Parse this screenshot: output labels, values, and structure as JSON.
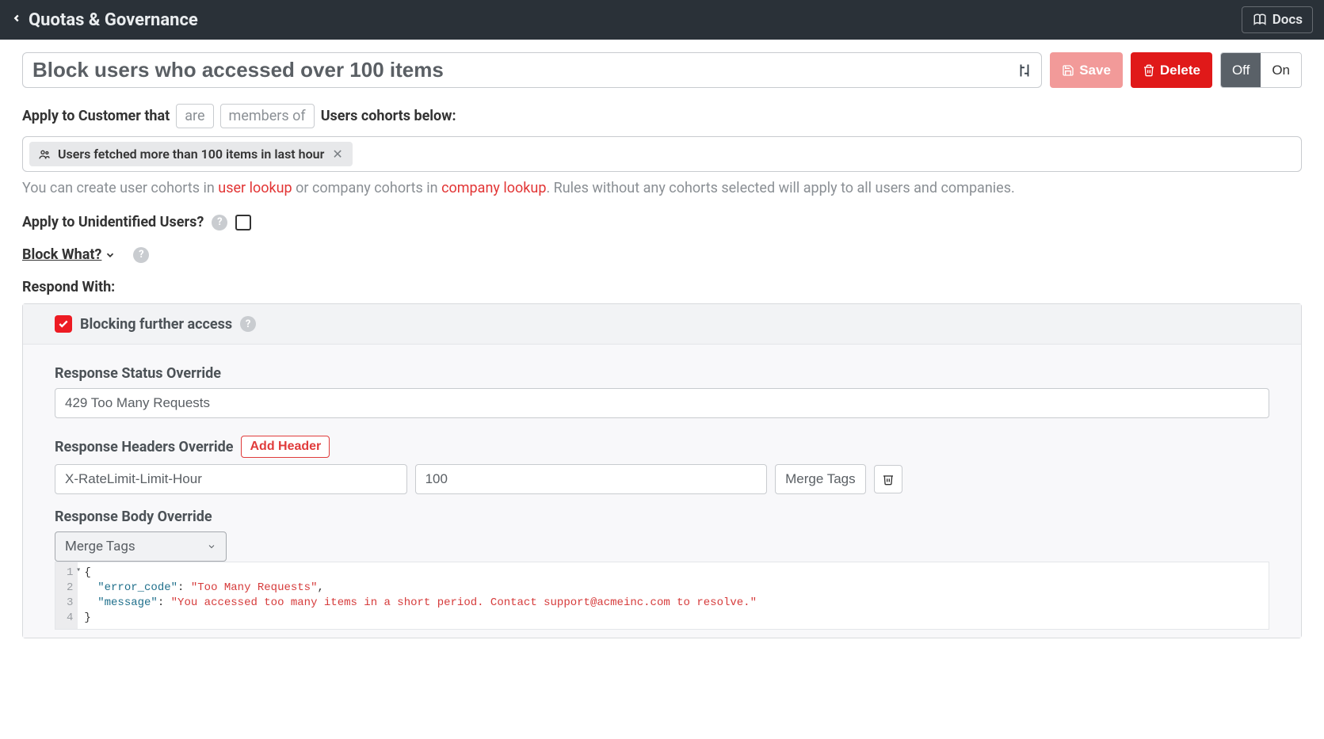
{
  "topbar": {
    "title": "Quotas & Governance",
    "docs_label": "Docs"
  },
  "rule": {
    "name": "Block users who accessed over 100 items",
    "save_label": "Save",
    "delete_label": "Delete",
    "toggle_off": "Off",
    "toggle_on": "On"
  },
  "apply": {
    "prefix": "Apply to Customer that",
    "are": "are",
    "members_of": "members of",
    "suffix": "Users cohorts below:"
  },
  "cohort": {
    "chip_label": "Users fetched more than 100 items in last hour"
  },
  "hint": {
    "p1": "You can create user cohorts in ",
    "link1": "user lookup",
    "p2": " or company cohorts in ",
    "link2": "company lookup",
    "p3": ". Rules without any cohorts selected will apply to all users and companies."
  },
  "unidentified_label": "Apply to Unidentified Users?",
  "block_what_label": "Block What?",
  "respond_with_label": "Respond With:",
  "blocking_label": "Blocking further access",
  "status_override": {
    "label": "Response Status Override",
    "value": "429 Too Many Requests"
  },
  "headers_override": {
    "label": "Response Headers Override",
    "add_btn": "Add Header",
    "key": "X-RateLimit-Limit-Hour",
    "value": "100",
    "merge_tags": "Merge Tags"
  },
  "body_override": {
    "label": "Response Body Override",
    "merge_tags": "Merge Tags",
    "code": {
      "line_numbers": [
        "1",
        "2",
        "3",
        "4"
      ],
      "l1": "{",
      "l2_key": "\"error_code\"",
      "l2_val": "\"Too Many Requests\"",
      "l3_key": "\"message\"",
      "l3_val": "\"You accessed too many items in a short period. Contact support@acmeinc.com to resolve.\"",
      "l4": "}"
    }
  }
}
